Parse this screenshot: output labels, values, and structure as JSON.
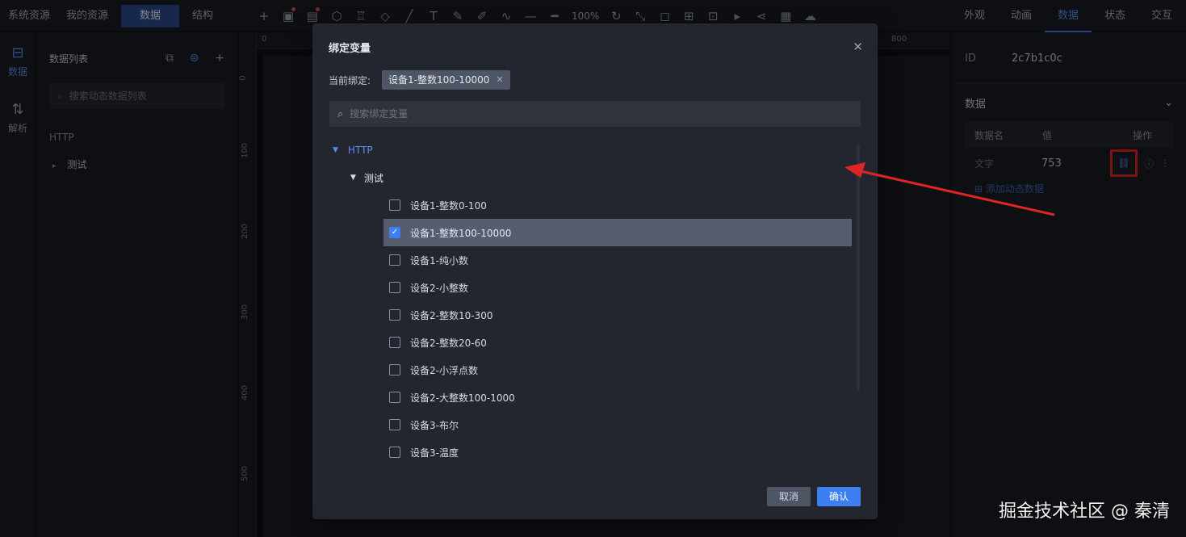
{
  "topbar": {
    "left_tabs": [
      "系统资源",
      "我的资源",
      "数据",
      "结构"
    ],
    "active_left_tab": 2,
    "zoom": "100%",
    "right_tabs": [
      "外观",
      "动画",
      "数据",
      "状态",
      "交互"
    ],
    "active_right_tab": 2
  },
  "rail": {
    "items": [
      {
        "label": "数据",
        "icon": "data-icon"
      },
      {
        "label": "解析",
        "icon": "parse-icon"
      }
    ]
  },
  "panel": {
    "title": "数据列表",
    "search_placeholder": "搜索动态数据列表",
    "section": "HTTP",
    "item": "测试"
  },
  "canvas": {
    "ruler_top": [
      "0",
      "800"
    ],
    "ruler_left": [
      "0",
      "100",
      "200",
      "300",
      "400",
      "500"
    ]
  },
  "right_panel": {
    "id_label": "ID",
    "id_value": "2c7b1c0c",
    "section": "数据",
    "columns": [
      "数据名",
      "值",
      "操作"
    ],
    "row": {
      "name": "文字",
      "value": "753"
    },
    "add_label": "添加动态数据"
  },
  "modal": {
    "title": "绑定变量",
    "current_label": "当前绑定:",
    "current_tag": "设备1-整数100-10000",
    "search_placeholder": "搜索绑定变量",
    "root": "HTTP",
    "group": "测试",
    "items": [
      {
        "label": "设备1-整数0-100",
        "checked": false
      },
      {
        "label": "设备1-整数100-10000",
        "checked": true
      },
      {
        "label": "设备1-纯小数",
        "checked": false
      },
      {
        "label": "设备2-小整数",
        "checked": false
      },
      {
        "label": "设备2-整数10-300",
        "checked": false
      },
      {
        "label": "设备2-整数20-60",
        "checked": false
      },
      {
        "label": "设备2-小浮点数",
        "checked": false
      },
      {
        "label": "设备2-大整数100-1000",
        "checked": false
      },
      {
        "label": "设备3-布尔",
        "checked": false
      },
      {
        "label": "设备3-温度",
        "checked": false
      }
    ],
    "cancel": "取消",
    "confirm": "确认"
  },
  "watermark": "掘金技术社区 @ 秦清",
  "colors": {
    "accent": "#3d7ef0",
    "annotation": "#e02424"
  }
}
